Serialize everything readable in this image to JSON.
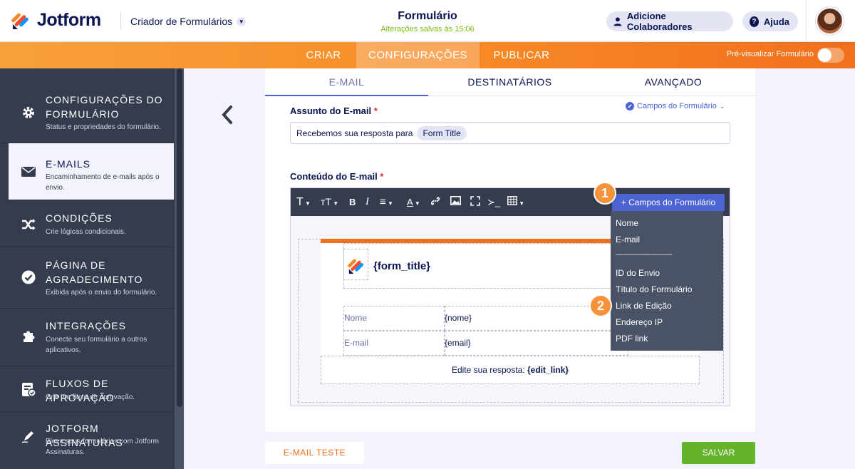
{
  "header": {
    "brand": "Jotform",
    "creator_label": "Criador de Formulários",
    "form_title": "Formulário",
    "save_status": "Alterações salvas às 15:06",
    "add_collaborators": "Adicione Colaboradores",
    "help": "Ajuda",
    "help_glyph": "?"
  },
  "nav": {
    "tabs": [
      "CRIAR",
      "CONFIGURAÇÕES",
      "PUBLICAR"
    ],
    "active": "CONFIGURAÇÕES",
    "preview_label": "Pré-visualizar Formulário"
  },
  "sidebar": {
    "items": [
      {
        "title_l1": "CONFIGURAÇÕES DO",
        "title_l2": "FORMULÁRIO",
        "desc_l1": "Status e propriedades do formulário.",
        "desc_l2": "",
        "icon": "gear-icon"
      },
      {
        "title_l1": "E-MAILS",
        "title_l2": "",
        "desc_l1": "Encaminhamento de e-mails após o",
        "desc_l2": "envio.",
        "icon": "envelope-icon"
      },
      {
        "title_l1": "CONDIÇÕES",
        "title_l2": "",
        "desc_l1": "Crie lógicas condicionais.",
        "desc_l2": "",
        "icon": "shuffle-icon"
      },
      {
        "title_l1": "PÁGINA DE",
        "title_l2": "AGRADECIMENTO",
        "desc_l1": "Exibida após o envio do formulário.",
        "desc_l2": "",
        "icon": "check-circle-icon"
      },
      {
        "title_l1": "INTEGRAÇÕES",
        "title_l2": "",
        "desc_l1": "Conecte seu formulário a outros",
        "desc_l2": "aplicativos.",
        "icon": "puzzle-icon"
      },
      {
        "title_l1": "FLUXOS DE APROVAÇÃO",
        "title_l2": "",
        "desc_l1": "Crie um fluxo de aprovação.",
        "desc_l2": "",
        "icon": "approval-icon"
      },
      {
        "title_l1": "JOTFORM ASSINATURAS",
        "title_l2": "",
        "desc_l1": "Eleve seus formulários com Jotform",
        "desc_l2": "Assinaturas.",
        "icon": "pen-icon"
      }
    ]
  },
  "tabs": {
    "items": [
      "E-MAIL",
      "DESTINATÁRIOS",
      "AVANÇADO"
    ],
    "active": "E-MAIL"
  },
  "email": {
    "subject_label": "Assunto do E-mail",
    "required_mark": "*",
    "form_fields_link": "Campos do Formulário",
    "subject_text": "Recebemos sua resposta para",
    "subject_tag": "Form Title",
    "content_label": "Conteúdo do E-mail"
  },
  "toolbar": {
    "glyphs": [
      "T",
      "ᴛT",
      "B",
      "I",
      "≡",
      "A",
      "🔗",
      "▣",
      "⤢",
      "≻_",
      "▦"
    ]
  },
  "template": {
    "title_placeholder": "{form_title}",
    "rows": [
      {
        "label": "Nome",
        "value": "{nome}"
      },
      {
        "label": "E-mail",
        "value": "{email}"
      }
    ],
    "edit_prefix": "Edite sua resposta:",
    "edit_tag": "{edit_link}"
  },
  "dropdown": {
    "button_label": "+ Campos do Formulário",
    "items": [
      "Nome",
      "E-mail",
      "----------------------------",
      "ID do Envio",
      "Título do Formulário",
      "Link de Edição",
      "Endereço IP",
      "PDF link"
    ]
  },
  "badges": [
    "1",
    "2"
  ],
  "footer": {
    "test_email": "E-MAIL TESTE",
    "save": "SALVAR"
  },
  "colors": {
    "accent_orange": "#f26f1c",
    "primary_blue": "#4c64d1",
    "sidebar_bg": "#343c4e",
    "save_green": "#64b32a"
  }
}
